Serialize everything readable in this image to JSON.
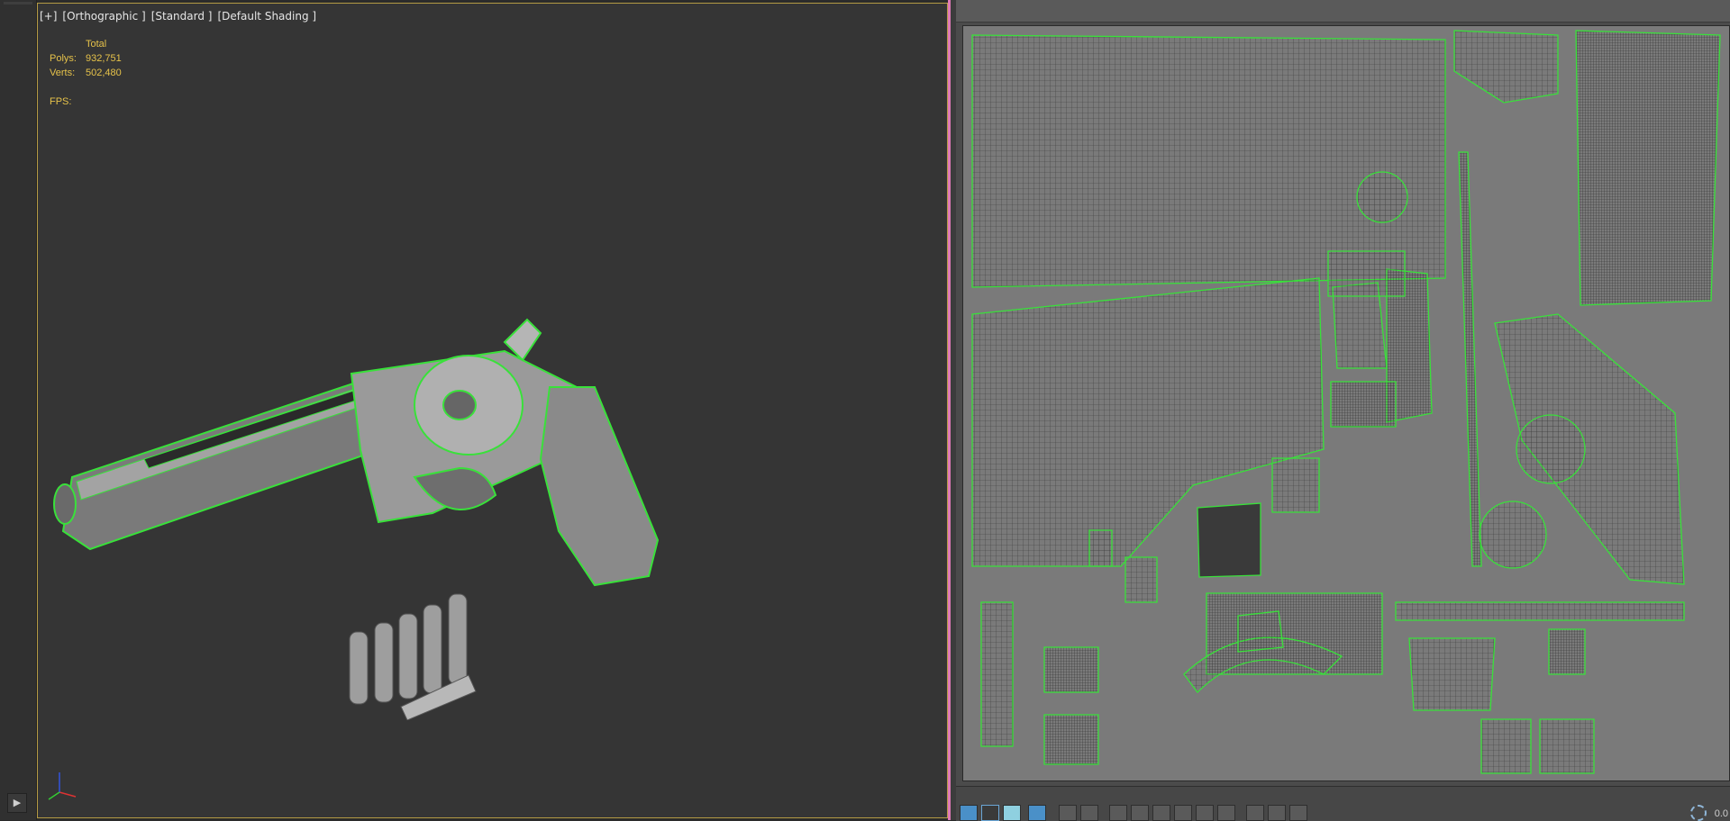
{
  "viewport": {
    "labels": [
      "[+]",
      "[Orthographic ]",
      "[Standard ]",
      "[Default Shading ]"
    ],
    "stats": {
      "total_label": "Total",
      "polys_label": "Polys:",
      "polys_value": "932,751",
      "verts_label": "Verts:",
      "verts_value": "502,480",
      "fps_label": "FPS:"
    },
    "gizmo_icon": "axis-gizmo-icon"
  },
  "uv_editor": {
    "zoom_value": "0.0",
    "toolbar_icons": [
      "uv-mode-icon",
      "square-select-icon",
      "cube-icon",
      "cube-cyan-icon",
      "grid-select-icon",
      "grid-select-2-icon",
      "grid-row-icon",
      "grid-row-2-icon",
      "grid-row-3-icon",
      "grid-row-4-icon",
      "grid-row-5-icon",
      "grid-row-6-icon",
      "brush-icon",
      "paint-icon",
      "paint-2-icon",
      "zoom-icon"
    ]
  },
  "colors": {
    "accent_border": "#b49a44",
    "uv_seam": "#39e13a",
    "divider": "#e07ab7",
    "stats_text": "#e6c24a"
  }
}
